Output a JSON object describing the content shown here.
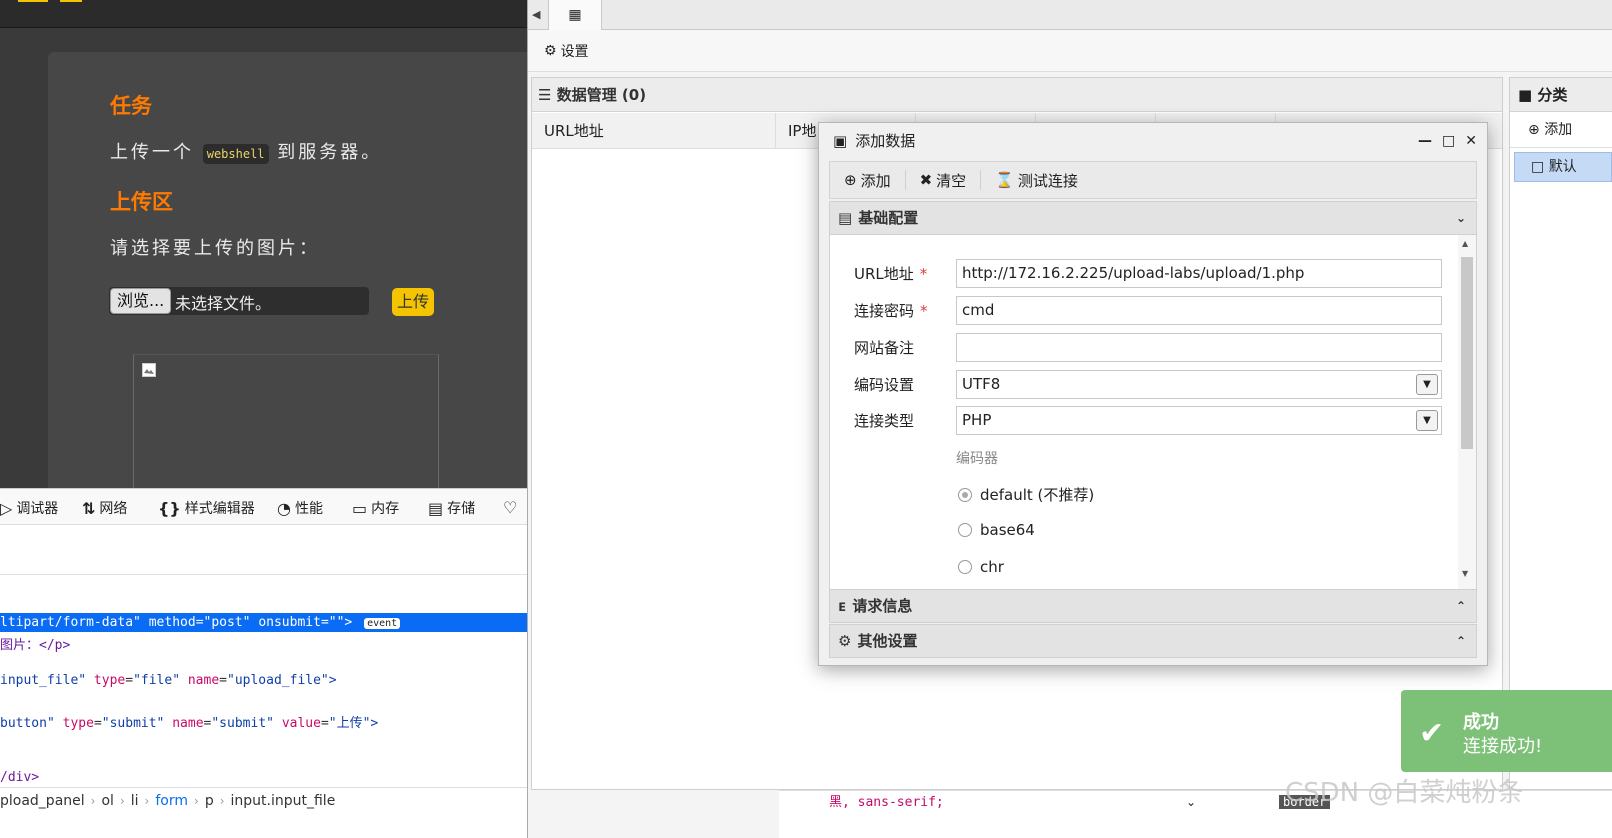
{
  "left_page": {
    "task_title": "任务",
    "task_text_before": "上传一个",
    "task_code": "webshell",
    "task_text_after": "到服务器。",
    "upload_title": "上传区",
    "choose_text": "请选择要上传的图片：",
    "browse_label": "浏览...",
    "file_label": "未选择文件。",
    "upload_button": "上传"
  },
  "devtools": {
    "tabs": [
      {
        "icon": "debugger-icon",
        "label": "调试器"
      },
      {
        "icon": "network-icon",
        "label": "网络"
      },
      {
        "icon": "style-editor-icon",
        "label": "样式编辑器"
      },
      {
        "icon": "performance-icon",
        "label": "性能"
      },
      {
        "icon": "memory-icon",
        "label": "内存"
      },
      {
        "icon": "storage-icon",
        "label": "存储"
      }
    ],
    "code": {
      "line1_a": "ltipart/form-data\"",
      "line1_method": "method",
      "line1_method_val": "\"post\"",
      "line1_onsubmit": "onsubmit",
      "line1_onsubmit_val": "\"\">",
      "event_badge": "event",
      "line2": "图片：</p>",
      "line3_a": "input_file\"",
      "line3_type": "type",
      "line3_type_val": "\"file\"",
      "line3_name": "name",
      "line3_name_val": "\"upload_file\">",
      "line4_a": "button\"",
      "line4_type": "type",
      "line4_type_val": "\"submit\"",
      "line4_name": "name",
      "line4_name_val": "\"submit\"",
      "line4_value": "value",
      "line4_value_val": "\"上传\">",
      "line5": "/div>"
    },
    "breadcrumb": [
      "pload_panel",
      "ol",
      "li",
      "form",
      "p",
      "input.input_file"
    ]
  },
  "ant": {
    "settings_label": "设置",
    "data_panel_title": "数据管理 (0)",
    "columns": [
      "URL地址",
      "IP地"
    ],
    "category_title": "分类",
    "category_add": "添加",
    "category_default": "默认"
  },
  "dialog": {
    "title": "添加数据",
    "toolbar": {
      "add": "添加",
      "clear": "清空",
      "test": "测试连接"
    },
    "basic_config": "基础配置",
    "fields": {
      "url_label": "URL地址",
      "url_value": "http://172.16.2.225/upload-labs/upload/1.php",
      "pwd_label": "连接密码",
      "pwd_value": "cmd",
      "note_label": "网站备注",
      "note_value": "",
      "encoding_label": "编码设置",
      "encoding_value": "UTF8",
      "type_label": "连接类型",
      "type_value": "PHP",
      "encoder_label": "编码器",
      "encoders": [
        "default (不推荐)",
        "base64",
        "chr"
      ],
      "required_mark": "*"
    },
    "request_info": "请求信息",
    "other_settings": "其他设置"
  },
  "toast": {
    "title": "成功",
    "message": "连接成功!"
  },
  "bottom": {
    "code": "黑, sans-serif;",
    "border_tag": "border"
  },
  "watermark": "CSDN @白菜炖粉条"
}
